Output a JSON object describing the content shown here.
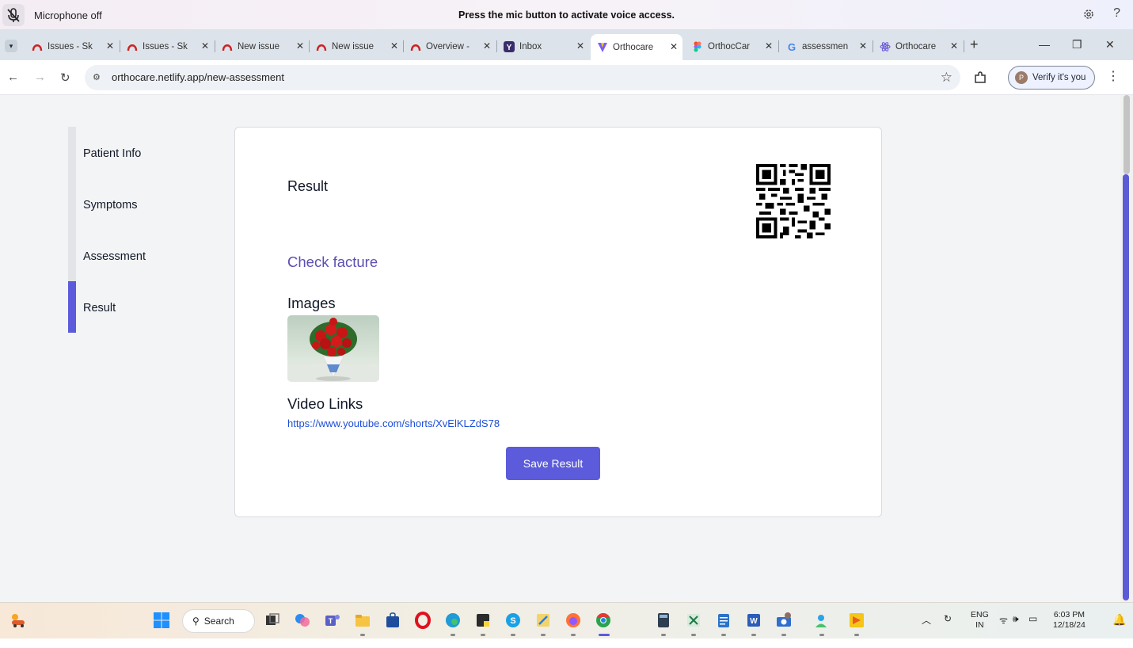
{
  "voice_access": {
    "status": "Microphone off",
    "message": "Press the mic button to activate voice access.",
    "help": "?"
  },
  "tabs": [
    {
      "title": "Issues - Sk",
      "icon": "github-like-icon"
    },
    {
      "title": "Issues - Sk",
      "icon": "github-like-icon"
    },
    {
      "title": "New issue",
      "icon": "github-like-icon"
    },
    {
      "title": "New issue",
      "icon": "github-like-icon"
    },
    {
      "title": "Overview -",
      "icon": "github-like-icon"
    },
    {
      "title": "Inbox",
      "icon": "yahoo-mail-icon"
    },
    {
      "title": "Orthocare",
      "icon": "vite-icon",
      "active": true
    },
    {
      "title": "OrthocCar",
      "icon": "figma-icon"
    },
    {
      "title": "assessmen",
      "icon": "google-icon"
    },
    {
      "title": "Orthocare",
      "icon": "react-icon"
    }
  ],
  "address": {
    "url": "orthocare.netlify.app/new-assessment",
    "verify_label": "Verify it's you",
    "avatar_letter": "P"
  },
  "steps": {
    "items": [
      {
        "label": "Patient Info"
      },
      {
        "label": "Symptoms"
      },
      {
        "label": "Assessment"
      },
      {
        "label": "Result"
      }
    ],
    "active_index": 3
  },
  "result": {
    "title": "Result",
    "check_link": "Check facture",
    "images_heading": "Images",
    "video_heading": "Video Links",
    "video_url": "https://www.youtube.com/shorts/XvElKLZdS78",
    "save_label": "Save Result"
  },
  "taskbar": {
    "search_label": "Search",
    "lang_line1": "ENG",
    "lang_line2": "IN",
    "time": "6:03 PM",
    "date": "12/18/24"
  },
  "colors": {
    "accent": "#5b5bdb",
    "link_purple": "#5b4fb3",
    "link_blue": "#1d4ed8"
  }
}
